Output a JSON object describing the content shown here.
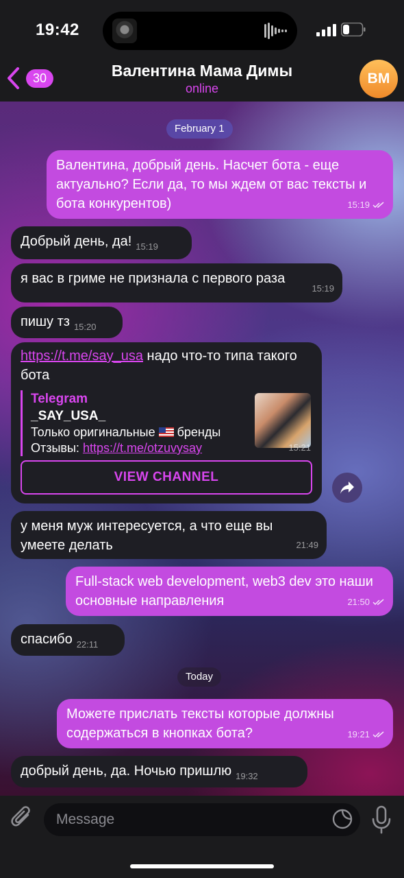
{
  "status_bar": {
    "time": "19:42"
  },
  "header": {
    "back_badge": "30",
    "title": "Валентина Мама Димы",
    "status": "online",
    "avatar_initials": "ВМ",
    "accent_color": "#d946ef"
  },
  "chat": {
    "date_feb": "February 1",
    "date_today": "Today",
    "messages": [
      {
        "dir": "out",
        "text": "Валентина, добрый день. Насчет бота - еще актуально? Если да, то мы ждем от вас тексты и бота конкурентов)",
        "time": "15:19",
        "read": true
      },
      {
        "dir": "in",
        "text": "Добрый день, да!",
        "time": "15:19"
      },
      {
        "dir": "in",
        "text": "я вас в гриме не признала с первого раза",
        "time": "15:19"
      },
      {
        "dir": "in",
        "text": "пишу тз",
        "time": "15:20"
      },
      {
        "dir": "in",
        "link": "https://t.me/say_usa",
        "text": " надо что-то типа такого бота",
        "time": "15:21",
        "preview": {
          "site": "Telegram",
          "title": "_SAY_USA_",
          "desc_before_flag": "Только оригинальные ",
          "flag": "🇺🇸",
          "desc_after_flag": " бренды",
          "reviews_label": "Отзывы: ",
          "reviews_link": "https://t.me/otzuvysay",
          "button": "VIEW CHANNEL"
        }
      },
      {
        "dir": "in",
        "text": "у меня муж интересуется, а что еще вы умеете делать",
        "time": "21:49"
      },
      {
        "dir": "out",
        "text": "Full-stack web development, web3 dev это наши основные направления",
        "time": "21:50",
        "read": true
      },
      {
        "dir": "in",
        "text": "спасибо",
        "time": "22:11"
      },
      {
        "dir": "out",
        "text": "Можете прислать тексты которые должны содержаться в кнопках бота?",
        "time": "19:21",
        "read": true
      },
      {
        "dir": "in",
        "text": "добрый день, да. Ночью пришлю",
        "time": "19:32"
      }
    ]
  },
  "composer": {
    "placeholder": "Message"
  },
  "icons": [
    "back-chevron-icon",
    "paperclip-icon",
    "sticker-icon",
    "microphone-icon",
    "share-icon",
    "double-check-icon"
  ]
}
